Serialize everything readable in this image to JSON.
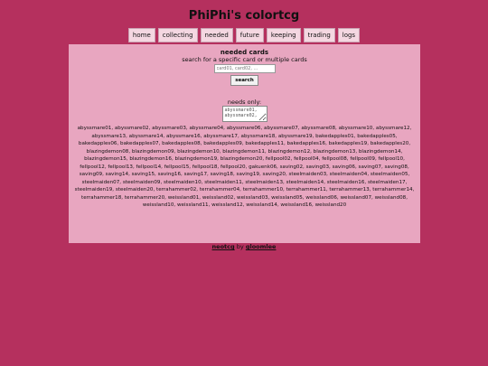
{
  "site_title": "PhiPhi's colortcg",
  "nav": [
    "home",
    "collecting",
    "needed",
    "future",
    "keeping",
    "trading",
    "logs"
  ],
  "page_heading": "needed cards",
  "search": {
    "instruction": "search for a specific card or multiple cards",
    "placeholder": "card01, card02, ...",
    "button_label": "search"
  },
  "needs_only": {
    "label": "needs only:",
    "value": "abyssmare01,\nabyssmare02,"
  },
  "cards": "abyssmare01, abyssmare02, abyssmare03, abyssmare04, abyssmare06, abyssmare07, abyssmare08, abyssmare10, abyssmare12, abyssmare13, abyssmare14, abyssmare16, abyssmare17, abyssmare18, abyssmare19, bakedapples01, bakedapples05, bakedapples06, bakedapples07, bakedapples08, bakedapples09, bakedapples11, bakedapples16, bakedapples19, bakedapples20, blazingdemon08, blazingdemon09, blazingdemon10, blazingdemon11, blazingdemon12, blazingdemon13, blazingdemon14, blazingdemon15, blazingdemon16, blazingdemon19, blazingdemon20, fellpool02, fellpool04, fellpool08, fellpool09, fellpool10, fellpool12, fellpool13, fellpool14, fellpool15, fellpool18, fellpool20, gakuenk06, saving02, saving03, saving06, saving07, saving08, saving09, saving14, saving15, saving16, saving17, saving18, saving19, saving20, steelmaiden03, steelmaiden04, steelmaiden05, steelmaiden07, steelmaiden09, steelmaiden10, steelmaiden11, steelmaiden13, steelmaiden14, steelmaiden16, steelmaiden17, steelmaiden19, steelmaiden20, terrahammer02, terrahammer04, terrahammer10, terrahammer11, terrahammer13, terrahammer14, terrahammer18, terrahammer20, weissland01, weissland02, weissland03, weissland05, weissland06, weissland07, weissland08, weissland10, weissland11, weissland12, weissland14, weissland16, weissland20",
  "footer": {
    "link1": "neotcg",
    "by": "by",
    "link2": "gloomlee"
  }
}
